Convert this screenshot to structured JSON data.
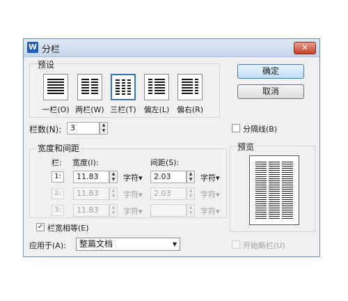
{
  "dialog": {
    "title": "分栏",
    "app_icon": "W",
    "close": "✕"
  },
  "presets": {
    "title": "预设",
    "items": [
      {
        "label": "一栏(O)",
        "columns": 1
      },
      {
        "label": "两栏(W)",
        "columns": 2
      },
      {
        "label": "三栏(T)",
        "columns": 3,
        "selected": true
      },
      {
        "label": "偏左(L)",
        "columns": "left"
      },
      {
        "label": "偏右(R)",
        "columns": "right"
      }
    ]
  },
  "buttons": {
    "ok": "确定",
    "cancel": "取消"
  },
  "columns_count": {
    "label": "栏数(N):",
    "value": "3"
  },
  "separator": {
    "label": "分隔线(B)",
    "checked": false
  },
  "width_spacing": {
    "title": "宽度和间距",
    "col_header": "栏:",
    "width_header": "宽度(I):",
    "spacing_header": "间距(S):",
    "unit": "字符",
    "rows": [
      {
        "num": "1:",
        "width": "11.83",
        "spacing": "2.03",
        "enabled": true
      },
      {
        "num": "2:",
        "width": "11.83",
        "spacing": "2.03",
        "enabled": false
      },
      {
        "num": "3:",
        "width": "11.83",
        "spacing": "",
        "enabled": false
      }
    ]
  },
  "equal_width": {
    "label": "栏宽相等(E)",
    "checked": true
  },
  "preview": {
    "title": "预览"
  },
  "apply_to": {
    "label": "应用于(A):",
    "value": "整篇文档"
  },
  "new_column": {
    "label": "开始新栏(U)",
    "checked": false
  }
}
